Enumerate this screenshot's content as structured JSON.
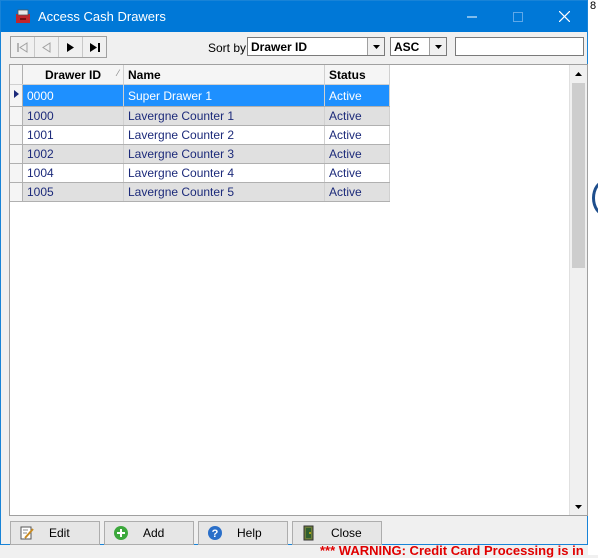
{
  "window": {
    "title": "Access Cash Drawers"
  },
  "toolbar": {
    "sort_label": "Sort by",
    "sort_field": "Drawer ID",
    "sort_order": "ASC",
    "search_value": ""
  },
  "grid": {
    "columns": [
      "Drawer ID",
      "Name",
      "Status"
    ],
    "rows": [
      {
        "id": "0000",
        "name": "Super Drawer 1",
        "status": "Active"
      },
      {
        "id": "1000",
        "name": "Lavergne Counter 1",
        "status": "Active"
      },
      {
        "id": "1001",
        "name": "Lavergne Counter 2",
        "status": "Active"
      },
      {
        "id": "1002",
        "name": "Lavergne Counter 3",
        "status": "Active"
      },
      {
        "id": "1004",
        "name": "Lavergne Counter 4",
        "status": "Active"
      },
      {
        "id": "1005",
        "name": "Lavergne Counter  5",
        "status": "Active"
      }
    ]
  },
  "buttons": {
    "edit": "Edit",
    "add": "Add",
    "help": "Help",
    "close": "Close"
  },
  "background": {
    "corner_char": "8",
    "warning": "*** WARNING: Credit Card Processing is in"
  },
  "colors": {
    "title_bar": "#0078d7",
    "selected_row": "#1e90ff",
    "row_text": "#1c2a7a",
    "warning_text": "#e00000"
  }
}
